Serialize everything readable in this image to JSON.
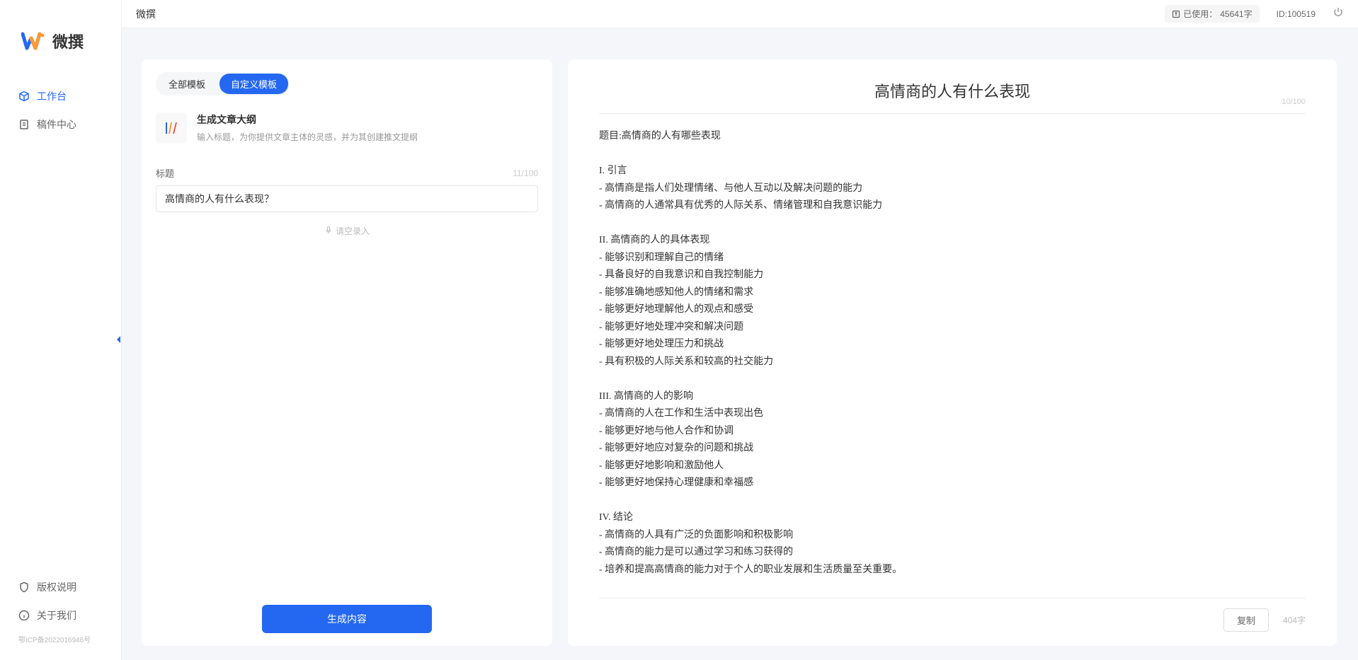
{
  "header": {
    "app_title": "微撰",
    "usage_label": "已使用：",
    "usage_value": "45641字",
    "user_id": "ID:100519"
  },
  "sidebar": {
    "logo_text": "微撰",
    "nav": [
      {
        "label": "工作台",
        "active": true
      },
      {
        "label": "稿件中心",
        "active": false
      }
    ],
    "bottom_nav": [
      {
        "label": "版权说明"
      },
      {
        "label": "关于我们"
      }
    ],
    "icp": "鄂ICP备2022016946号"
  },
  "left_panel": {
    "tabs": [
      {
        "label": "全部模板",
        "active": false
      },
      {
        "label": "自定义模板",
        "active": true
      }
    ],
    "template": {
      "name": "生成文章大纲",
      "desc": "输入标题，为你提供文章主体的灵感，并为其创建推文提纲"
    },
    "form": {
      "label": "标题",
      "count": "11/100",
      "value": "高情商的人有什么表现？",
      "voice_label": "请空录入"
    },
    "generate_label": "生成内容"
  },
  "right_panel": {
    "title": "高情商的人有什么表现",
    "title_count": "10/100",
    "content": "题目:高情商的人有哪些表现\n\nI. 引言\n- 高情商是指人们处理情绪、与他人互动以及解决问题的能力\n- 高情商的人通常具有优秀的人际关系、情绪管理和自我意识能力\n\nII. 高情商的人的具体表现\n- 能够识别和理解自己的情绪\n- 具备良好的自我意识和自我控制能力\n- 能够准确地感知他人的情绪和需求\n- 能够更好地理解他人的观点和感受\n- 能够更好地处理冲突和解决问题\n- 能够更好地处理压力和挑战\n- 具有积极的人际关系和较高的社交能力\n\nIII. 高情商的人的影响\n- 高情商的人在工作和生活中表现出色\n- 能够更好地与他人合作和协调\n- 能够更好地应对复杂的问题和挑战\n- 能够更好地影响和激励他人\n- 能够更好地保持心理健康和幸福感\n\nIV. 结论\n- 高情商的人具有广泛的负面影响和积极影响\n- 高情商的能力是可以通过学习和练习获得的\n- 培养和提高高情商的能力对于个人的职业发展和生活质量至关重要。",
    "copy_label": "复制",
    "word_count": "404字"
  }
}
